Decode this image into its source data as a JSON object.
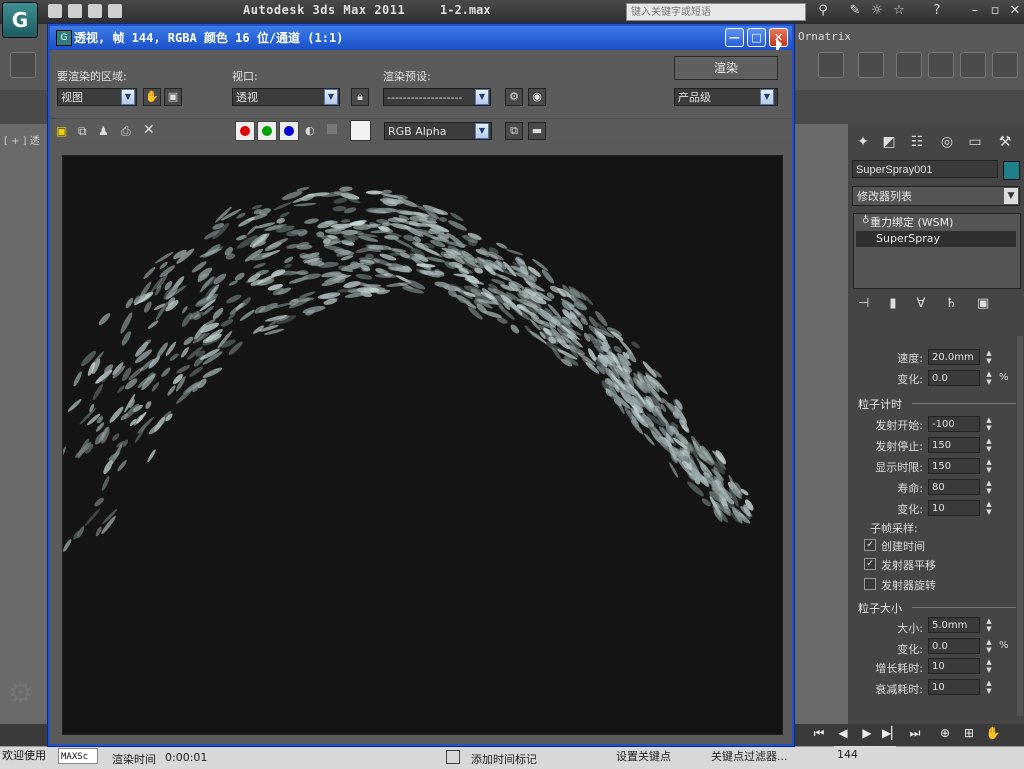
{
  "app": {
    "title": "Autodesk 3ds Max  2011",
    "file": "1-2.max",
    "search_placeholder": "键入关键字或短语",
    "ribbon_plugin": "Ornatrix",
    "viewport_label": "[ + ] 透"
  },
  "render_window": {
    "title": "透视, 帧 144, RGBA 颜色 16 位/通道 (1:1)",
    "area_label": "要渲染的区域:",
    "area_value": "视图",
    "viewport_label": "视口:",
    "viewport_value": "透视",
    "preset_label": "渲染预设:",
    "preset_value": "-------------------",
    "render_button": "渲染",
    "quality_value": "产品级",
    "channel_value": "RGB Alpha",
    "channel_colors": {
      "red": "#e00000",
      "green": "#00a000",
      "blue": "#0000d0"
    },
    "minimize_glyph": "—",
    "maximize_glyph": "□",
    "close_glyph": "✕"
  },
  "command_panel": {
    "object_name": "SuperSpray001",
    "object_color": "#1f7f8a",
    "modifier_list": "修改器列表",
    "stack": [
      "重力绑定 (WSM)",
      "SuperSpray"
    ],
    "rows": [
      {
        "label": "速度:",
        "value": "20.0mm",
        "unit": ""
      },
      {
        "label": "变化:",
        "value": "0.0",
        "unit": "%"
      }
    ],
    "group_timing": "粒子计时",
    "timing_rows": [
      {
        "label": "发射开始:",
        "value": "-100"
      },
      {
        "label": "发射停止:",
        "value": "150"
      },
      {
        "label": "显示时限:",
        "value": "150"
      },
      {
        "label": "寿命:",
        "value": "80"
      },
      {
        "label": "变化:",
        "value": "10"
      }
    ],
    "subframe_label": "子帧采样:",
    "checkboxes": [
      {
        "label": "创建时间",
        "checked": true
      },
      {
        "label": "发射器平移",
        "checked": true
      },
      {
        "label": "发射器旋转",
        "checked": false
      }
    ],
    "group_size": "粒子大小",
    "size_rows": [
      {
        "label": "大小:",
        "value": "5.0mm",
        "unit": ""
      },
      {
        "label": "变化:",
        "value": "0.0",
        "unit": "%"
      },
      {
        "label": "增长耗时:",
        "value": "10",
        "unit": ""
      },
      {
        "label": "衰减耗时:",
        "value": "10",
        "unit": ""
      }
    ]
  },
  "status": {
    "welcome": "欢迎使用",
    "maxscript": "MAXSc",
    "render_time_label": "渲染时间",
    "render_time_value": "0:00:01",
    "add_time_tag": "添加时间标记",
    "set_key": "设置关键点",
    "key_filters": "关键点过滤器...",
    "frame": "144"
  }
}
